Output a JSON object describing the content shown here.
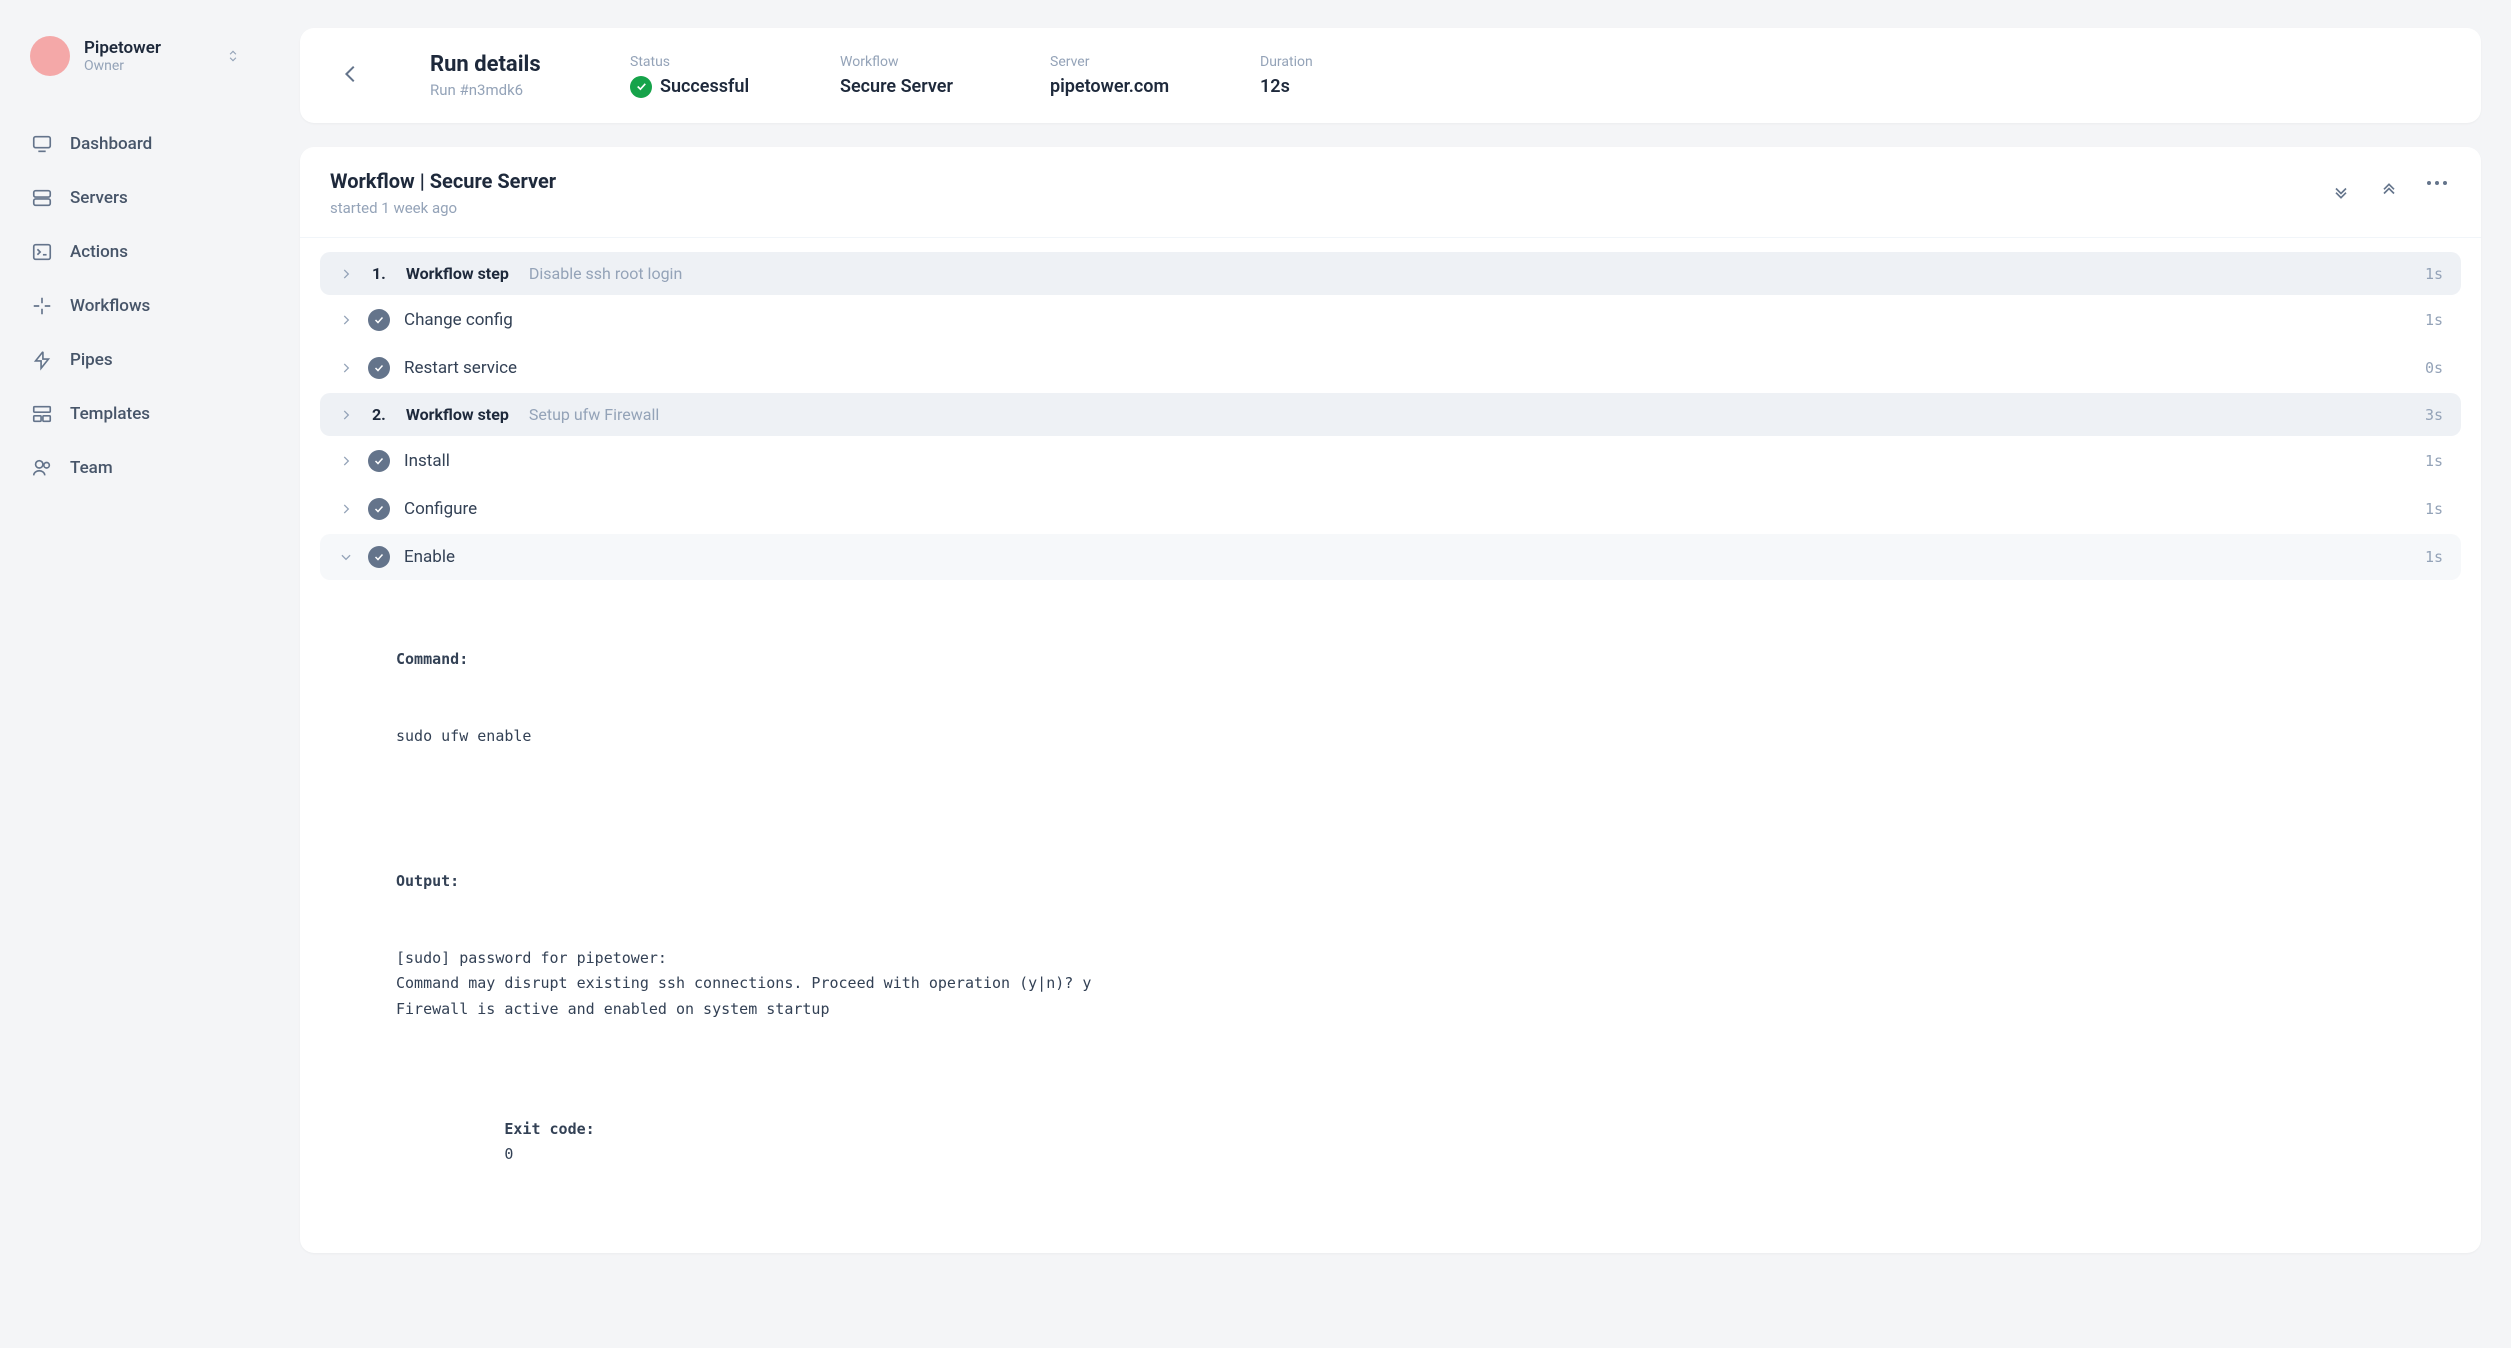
{
  "org": {
    "name": "Pipetower",
    "role": "Owner"
  },
  "nav": [
    {
      "label": "Dashboard"
    },
    {
      "label": "Servers"
    },
    {
      "label": "Actions"
    },
    {
      "label": "Workflows"
    },
    {
      "label": "Pipes"
    },
    {
      "label": "Templates"
    },
    {
      "label": "Team"
    }
  ],
  "header": {
    "title": "Run details",
    "subtitle": "Run #n3mdk6",
    "status_label": "Status",
    "status_value": "Successful",
    "workflow_label": "Workflow",
    "workflow_value": "Secure Server",
    "server_label": "Server",
    "server_value": "pipetower.com",
    "duration_label": "Duration",
    "duration_value": "12s"
  },
  "workflow": {
    "title": "Workflow | Secure Server",
    "started": "started 1 week ago"
  },
  "steps": {
    "g1_num": "1.",
    "g1_label": "Workflow step",
    "g1_desc": "Disable ssh root login",
    "g1_dur": "1s",
    "s1_name": "Change config",
    "s1_dur": "1s",
    "s2_name": "Restart service",
    "s2_dur": "0s",
    "g2_num": "2.",
    "g2_label": "Workflow step",
    "g2_desc": "Setup ufw Firewall",
    "g2_dur": "3s",
    "s3_name": "Install",
    "s3_dur": "1s",
    "s4_name": "Configure",
    "s4_dur": "1s",
    "s5_name": "Enable",
    "s5_dur": "1s"
  },
  "output": {
    "command_label": "Command:",
    "command": "sudo ufw enable",
    "output_label": "Output:",
    "output_text": "[sudo] password for pipetower:\nCommand may disrupt existing ssh connections. Proceed with operation (y|n)? y\nFirewall is active and enabled on system startup",
    "exit_label": "Exit code:",
    "exit_code": "0"
  }
}
